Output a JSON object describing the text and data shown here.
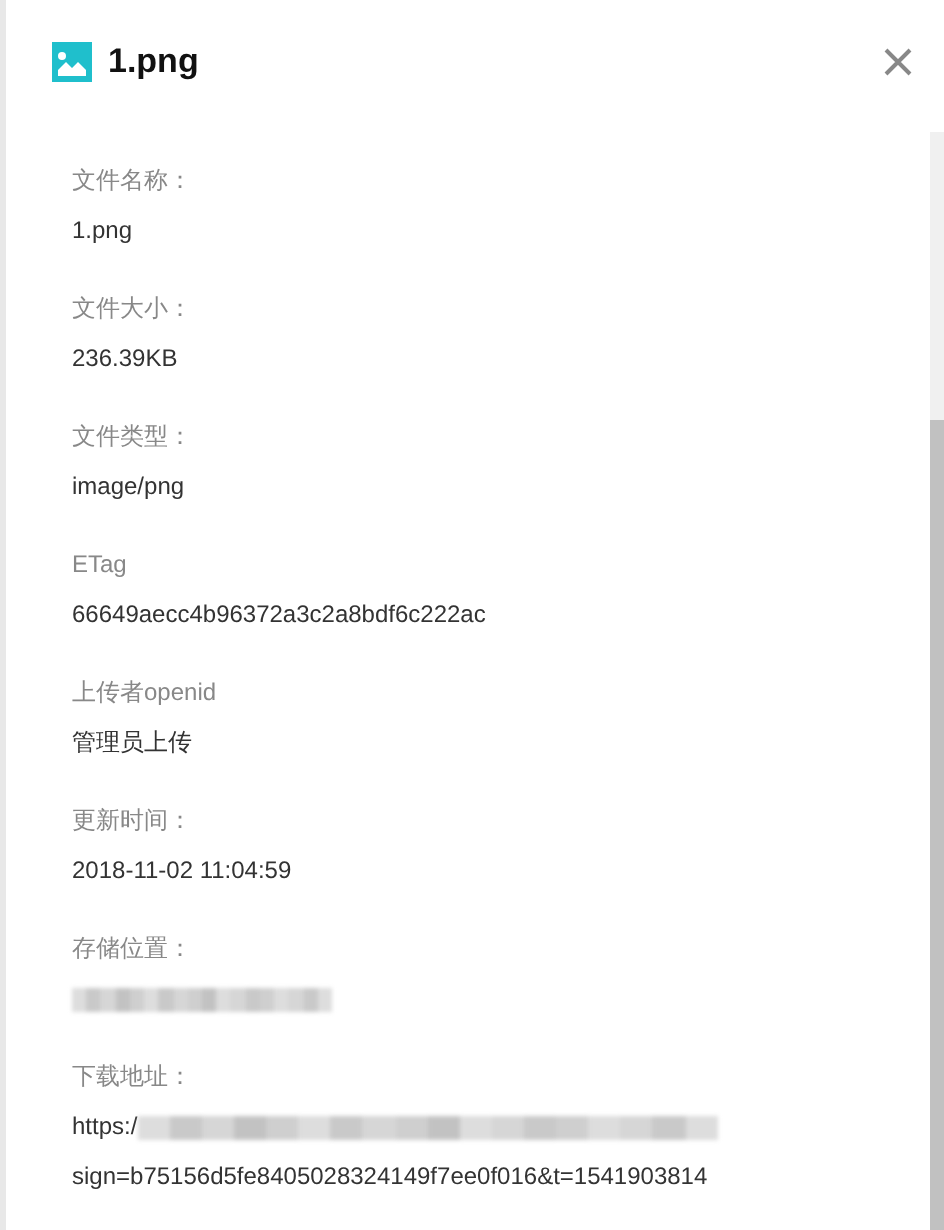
{
  "header": {
    "title": "1.png"
  },
  "fields": [
    {
      "label": "文件名称：",
      "lines": [
        [
          {
            "kind": "text",
            "text": "1.png"
          }
        ]
      ]
    },
    {
      "label": "文件大小：",
      "lines": [
        [
          {
            "kind": "text",
            "text": "236.39KB"
          }
        ]
      ]
    },
    {
      "label": "文件类型：",
      "lines": [
        [
          {
            "kind": "text",
            "text": "image/png"
          }
        ]
      ]
    },
    {
      "label": "ETag",
      "lines": [
        [
          {
            "kind": "text",
            "text": "66649aecc4b96372a3c2a8bdf6c222ac"
          }
        ]
      ]
    },
    {
      "label": "上传者openid",
      "lines": [
        [
          {
            "kind": "text",
            "text": "管理员上传"
          }
        ]
      ]
    },
    {
      "label": "更新时间：",
      "lines": [
        [
          {
            "kind": "text",
            "text": "2018-11-02 11:04:59"
          }
        ]
      ]
    },
    {
      "label": "存储位置：",
      "lines": [
        [
          {
            "kind": "blurred"
          }
        ]
      ]
    },
    {
      "label": "下载地址：",
      "lines": [
        [
          {
            "kind": "text",
            "text": "https:/"
          },
          {
            "kind": "blurred"
          }
        ],
        [
          {
            "kind": "text",
            "text": "sign=b75156d5fe8405028324149f7ee0f016&t=1541903814"
          }
        ]
      ]
    }
  ]
}
